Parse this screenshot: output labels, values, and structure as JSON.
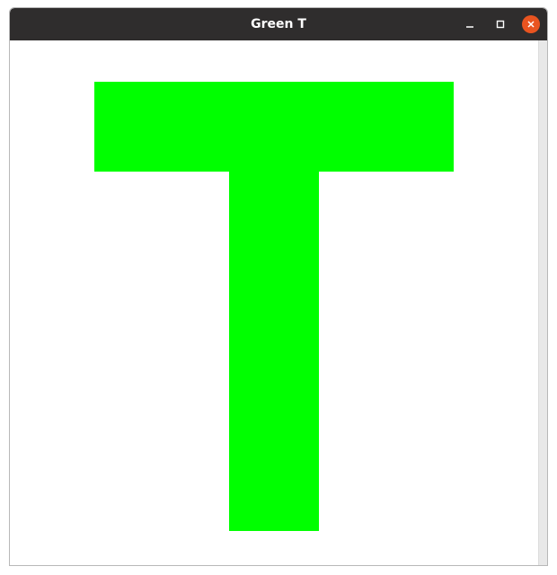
{
  "window": {
    "title": "Green T"
  },
  "icons": {
    "minimize": "minimize-icon",
    "maximize": "maximize-icon",
    "close": "close-icon"
  },
  "colors": {
    "titlebar": "#2f2d2d",
    "close_button": "#e95420",
    "shape_fill": "#00ff00",
    "canvas_background": "#ffffff"
  }
}
